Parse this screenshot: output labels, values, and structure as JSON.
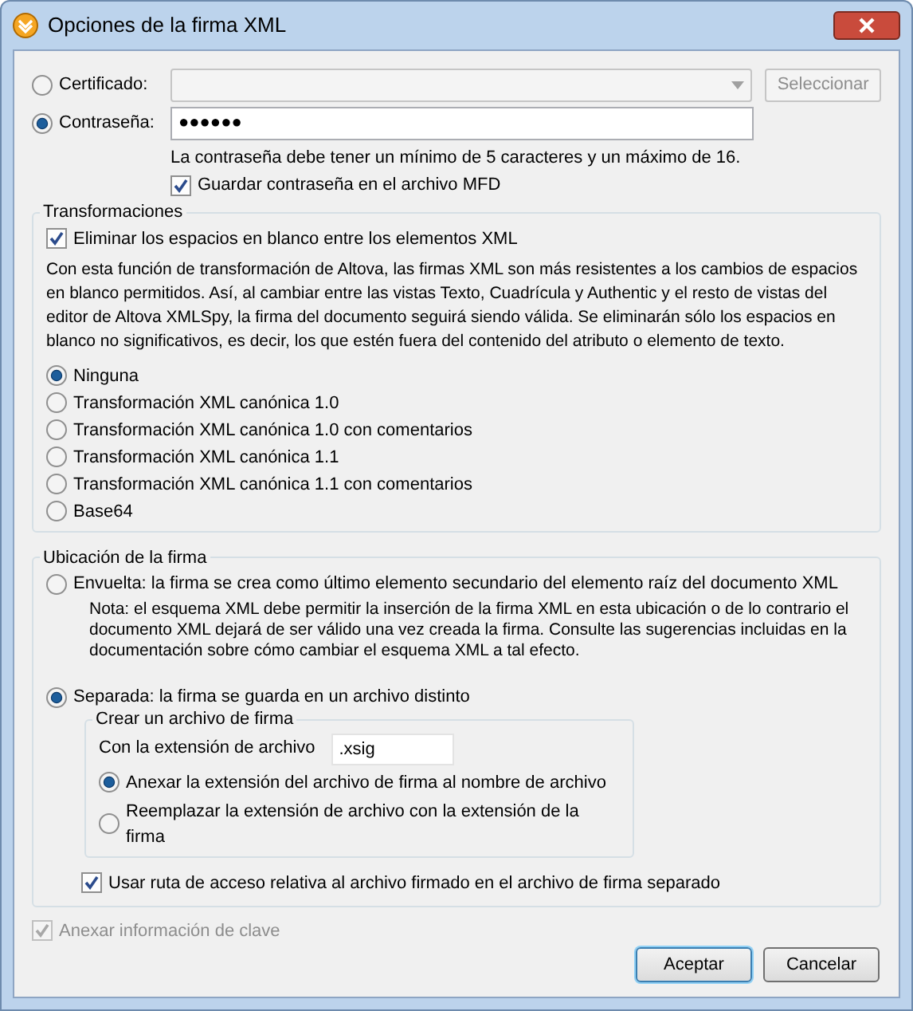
{
  "window": {
    "title": "Opciones de la firma XML"
  },
  "certificate": {
    "label": "Certificado:",
    "selected": false,
    "disabled": true,
    "button": "Seleccionar"
  },
  "password": {
    "label": "Contraseña:",
    "selected": true,
    "value": "●●●●●●",
    "hint": "La contraseña debe tener un mínimo de 5 caracteres y un máximo de 16.",
    "save": {
      "label": "Guardar contraseña en el archivo MFD",
      "checked": true
    }
  },
  "transformations": {
    "title": "Transformaciones",
    "strip": {
      "label": "Eliminar los espacios en blanco entre los elementos XML",
      "checked": true
    },
    "description": "Con esta función de transformación de Altova, las firmas XML son más resistentes a los cambios de espacios en blanco permitidos. Así, al cambiar entre las vistas Texto, Cuadrícula y Authentic y el resto de vistas del editor de Altova XMLSpy, la firma del documento seguirá siendo válida. Se eliminarán sólo los espacios en blanco no significativos, es decir, los que estén fuera del contenido del atributo o elemento de texto.",
    "options": [
      {
        "label": "Ninguna",
        "selected": true
      },
      {
        "label": "Transformación XML canónica 1.0",
        "selected": false
      },
      {
        "label": "Transformación XML canónica 1.0 con comentarios",
        "selected": false
      },
      {
        "label": "Transformación XML canónica 1.1",
        "selected": false
      },
      {
        "label": "Transformación XML canónica 1.1 con comentarios",
        "selected": false
      },
      {
        "label": "Base64",
        "selected": false
      }
    ]
  },
  "location": {
    "title": "Ubicación de la firma",
    "enveloped": {
      "label": "Envuelta: la firma se crea como último elemento secundario del elemento raíz del documento XML",
      "selected": false,
      "note": "Nota: el esquema XML debe permitir la inserción de la firma XML en esta ubicación o de lo contrario el documento XML dejará de ser válido una vez creada la firma. Consulte las sugerencias incluidas en la documentación sobre cómo cambiar el esquema XML a tal efecto."
    },
    "detached": {
      "label": "Separada: la firma se guarda en un archivo distinto",
      "selected": true,
      "file_group": {
        "title": "Crear un archivo de firma",
        "extension_label": "Con la extensión de archivo",
        "extension_value": ".xsig",
        "options": [
          {
            "label": "Anexar la extensión del archivo de firma al nombre de archivo",
            "selected": true
          },
          {
            "label": "Reemplazar la extensión de archivo con la extensión de la firma",
            "selected": false
          }
        ]
      }
    },
    "relative_path": {
      "label": "Usar ruta de acceso relativa al archivo firmado en el archivo de firma separado",
      "checked": true
    }
  },
  "key_info": {
    "label": "Anexar información de clave",
    "checked": true,
    "disabled": true
  },
  "buttons": [
    {
      "label": "Aceptar",
      "default": true
    },
    {
      "label": "Cancelar",
      "default": false
    }
  ]
}
